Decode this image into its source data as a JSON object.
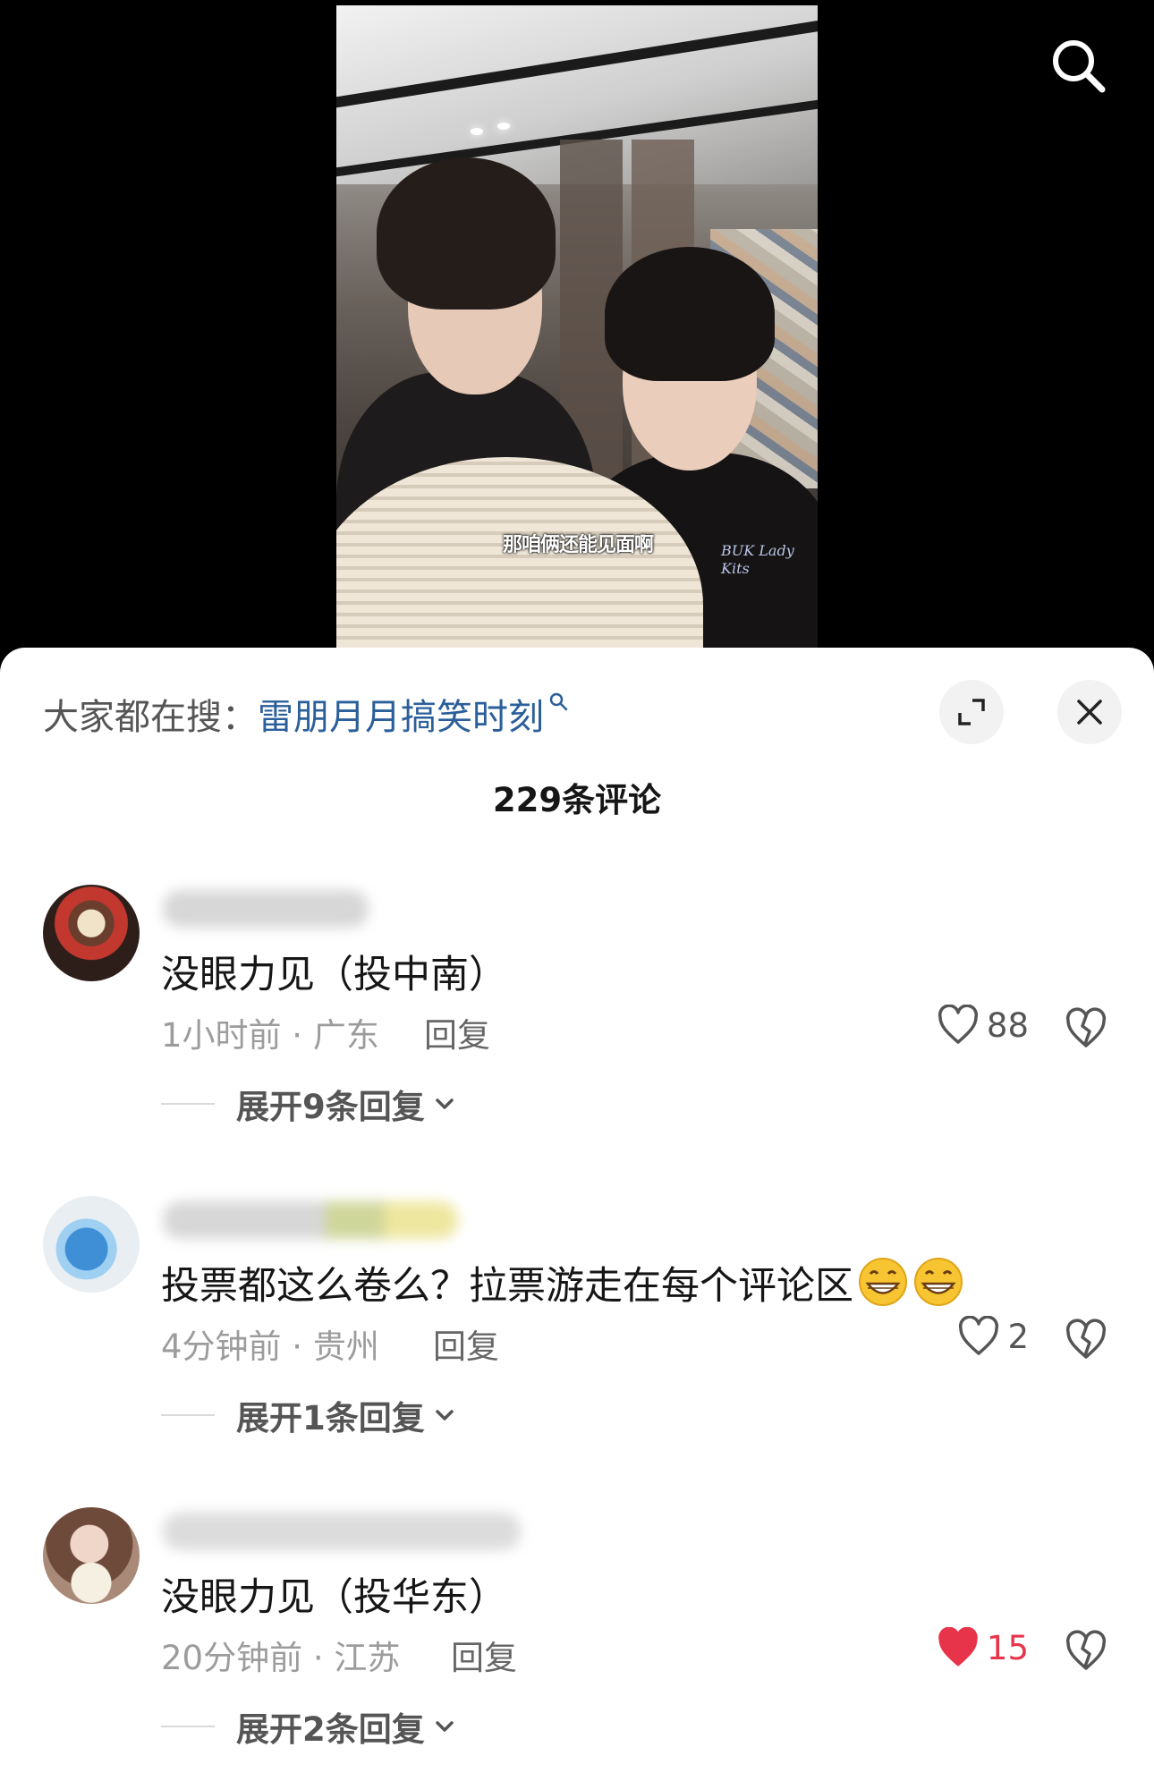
{
  "video": {
    "subtitle": "那咱俩还能见面啊",
    "shirt_text": "BUK Lady Kits"
  },
  "panel": {
    "hot_search_prefix": "大家都在搜：",
    "hot_search_term": "雷朋月月搞笑时刻",
    "comment_count": "229条评论"
  },
  "comments": [
    {
      "text": "没眼力见（投中南）",
      "time_location": "1小时前 · 广东",
      "reply_label": "回复",
      "likes": "88",
      "liked": false,
      "expand_label": "展开9条回复"
    },
    {
      "text": "投票都这么卷么？拉票游走在每个评论区",
      "time_location": "4分钟前 · 贵州",
      "reply_label": "回复",
      "likes": "2",
      "liked": false,
      "expand_label": "展开1条回复"
    },
    {
      "text": "没眼力见（投华东）",
      "time_location": "20分钟前 · 江苏",
      "reply_label": "回复",
      "likes": "15",
      "liked": true,
      "expand_label": "展开2条回复"
    }
  ],
  "colors": {
    "accent_link": "#2b5f9a",
    "liked_heart": "#e8344b",
    "muted_text": "#9c9c9c"
  },
  "icons": [
    "search-icon",
    "expand-icon",
    "close-icon",
    "heart-icon",
    "dislike-icon",
    "chevron-down-icon",
    "grin-emoji-icon"
  ]
}
